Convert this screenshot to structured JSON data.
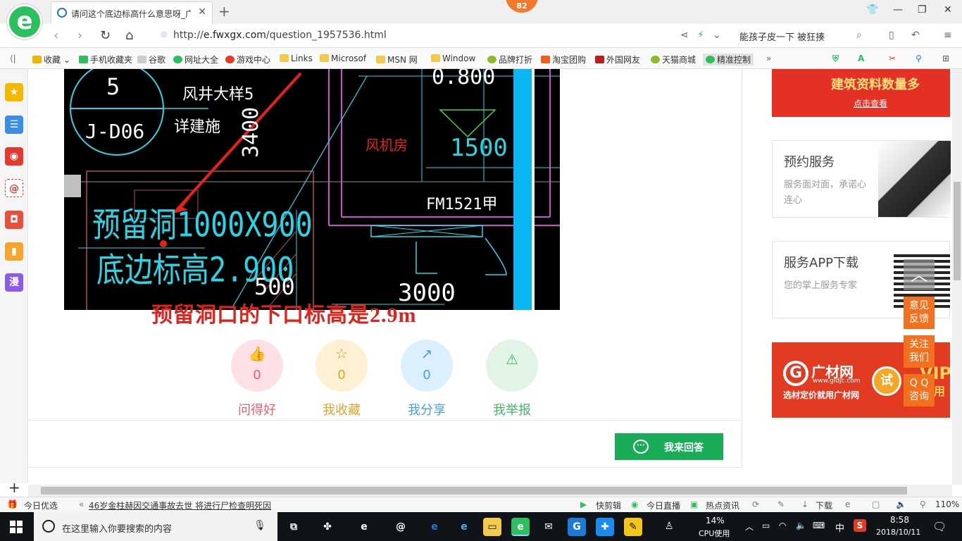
{
  "browser": {
    "tab_title": "请问这个底边标高什么意思呀_广",
    "notif_count": "82",
    "url_prefix": "http://",
    "url_host": "e.fwxgx.com",
    "url_path": "/question_1957536.html",
    "hot_search": "能孩子皮一下 被狂揍"
  },
  "bookmarks": [
    {
      "label": "收藏",
      "color": "#f0b400"
    },
    {
      "label": "手机收藏夹",
      "color": "#2cbf5d"
    },
    {
      "label": "谷歌",
      "color": "#bbbbbb"
    },
    {
      "label": "网址大全",
      "color": "#2cbf5d"
    },
    {
      "label": "游戏中心",
      "color": "#e23b22"
    },
    {
      "label": "Links",
      "color": "#f3c94b"
    },
    {
      "label": "Microsof",
      "color": "#f3c94b"
    },
    {
      "label": "MSN 网",
      "color": "#f3c94b"
    },
    {
      "label": "Window",
      "color": "#f3c94b"
    },
    {
      "label": "品牌打折",
      "color": "#8bbd2a"
    },
    {
      "label": "淘宝团购",
      "color": "#f25d1c"
    },
    {
      "label": "外国网友",
      "color": "#c01b1b"
    },
    {
      "label": "天猫商城",
      "color": "#8bbd2a"
    },
    {
      "label": "精准控制",
      "color": "#2cbf5d"
    }
  ],
  "sidebar_icons": [
    "favorites-icon",
    "reader-icon",
    "weibo-icon",
    "mail-icon",
    "game-icon",
    "notes-icon",
    "comic-icon"
  ],
  "sidebar_comic_label": "漫",
  "cad": {
    "circle_num": "5",
    "circle_code": "J-D06",
    "shaft_title": "风井大样5",
    "see_arch": "详建施",
    "dim_3400": "3400",
    "fan_room": "风机房",
    "elev_0800": "0.800",
    "elev_1500": "1500",
    "door_code": "FM1521甲",
    "opening_line1": "预留洞1000X900",
    "opening_line2": "底边标高2.900",
    "dim_500": "500",
    "dim_3000": "3000"
  },
  "caption": "预留洞口的下口标高是2.9m",
  "actions": [
    {
      "label": "问得好",
      "count": "0",
      "bg": "#fde1e5",
      "fg": "#e8606e",
      "glyph": "👍"
    },
    {
      "label": "我收藏",
      "count": "0",
      "bg": "#fdf0d3",
      "fg": "#e0a42b",
      "glyph": "☆"
    },
    {
      "label": "我分享",
      "count": "0",
      "bg": "#dcefff",
      "fg": "#4a9ee6",
      "glyph": "↗"
    },
    {
      "label": "我举报",
      "count": "0",
      "bg": "#e0f5e6",
      "fg": "#43b565",
      "glyph": "⚠"
    }
  ],
  "answer_button": "我来回答",
  "right": {
    "ad_top_title": "建筑资料数量多",
    "ad_top_link": "点击查看",
    "service_title": "预约服务",
    "service_sub": "服务面对面，承诺心连心",
    "app_title": "服务APP下载",
    "app_sub": "您的掌上服务专家",
    "gc_brand": "广材网",
    "gc_site": "www.gldjc.com",
    "gc_slogan": "选材定价就用广材网",
    "gc_try": "试",
    "gc_vip": "VIP",
    "gc_vip_sub": "试用"
  },
  "float_buttons": [
    "意见\n反馈",
    "关注\n我们",
    "Q Q\n咨询"
  ],
  "statusbar": {
    "today": "今日优选",
    "news": "46岁金柱赫因交通事故去世 将进行尸检查明死因",
    "clip": "快剪辑",
    "live": "今日直播",
    "hot": "热点资讯",
    "download": "下载",
    "zoom": "110%"
  },
  "taskbar": {
    "search_placeholder": "在这里输入你要搜索的内容",
    "cpu_percent": "14%",
    "cpu_label": "CPU使用",
    "ime": "中",
    "time": "8:58",
    "date": "2018/10/11"
  }
}
